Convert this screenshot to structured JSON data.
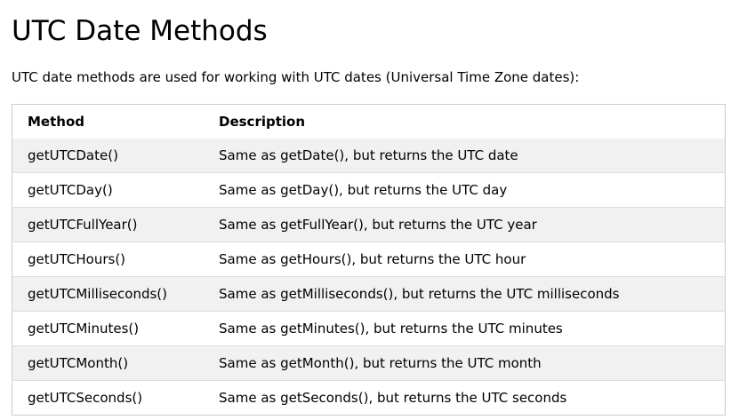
{
  "title": "UTC Date Methods",
  "intro": "UTC date methods are used for working with UTC dates (Universal Time Zone dates):",
  "table": {
    "headers": {
      "method": "Method",
      "description": "Description"
    },
    "rows": [
      {
        "method": "getUTCDate()",
        "description": "Same as getDate(), but returns the UTC date"
      },
      {
        "method": "getUTCDay()",
        "description": "Same as getDay(), but returns the UTC day"
      },
      {
        "method": "getUTCFullYear()",
        "description": "Same as getFullYear(), but returns the UTC year"
      },
      {
        "method": "getUTCHours()",
        "description": "Same as getHours(), but returns the UTC hour"
      },
      {
        "method": "getUTCMilliseconds()",
        "description": "Same as getMilliseconds(), but returns the UTC milliseconds"
      },
      {
        "method": "getUTCMinutes()",
        "description": "Same as getMinutes(), but returns the UTC minutes"
      },
      {
        "method": "getUTCMonth()",
        "description": "Same as getMonth(), but returns the UTC month"
      },
      {
        "method": "getUTCSeconds()",
        "description": "Same as getSeconds(), but returns the UTC seconds"
      }
    ]
  },
  "colors": {
    "stripe": "#f1f1f1",
    "border": "#cccccc"
  }
}
